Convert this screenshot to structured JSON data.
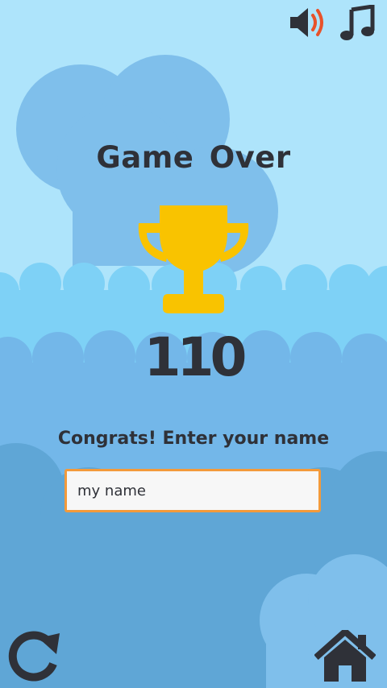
{
  "screen": {
    "title": "Game Over",
    "score": "110",
    "prompt": "Congrats! Enter your name"
  },
  "name_input": {
    "value": "my name",
    "placeholder": ""
  },
  "icons": {
    "sound": "speaker-icon",
    "music": "music-note-icon",
    "restart": "restart-icon",
    "home": "home-icon",
    "trophy": "trophy-icon"
  },
  "colors": {
    "sky": "#aee4fb",
    "cloud": "#7fbfeb",
    "trophy": "#f9c300",
    "text": "#2f3138",
    "input_border": "#f39a3b",
    "speaker_waves": "#e8522a"
  }
}
